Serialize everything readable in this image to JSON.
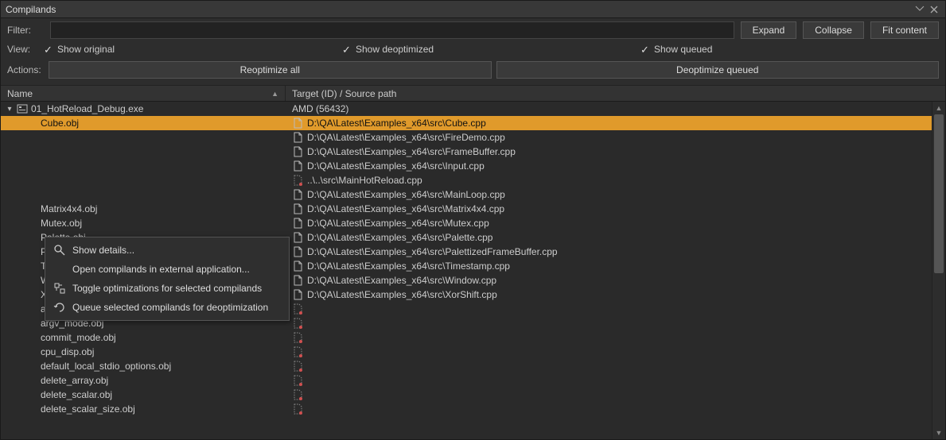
{
  "window": {
    "title": "Compilands"
  },
  "toolbar": {
    "filter_label": "Filter:",
    "expand": "Expand",
    "collapse": "Collapse",
    "fit": "Fit content"
  },
  "view": {
    "label": "View:",
    "original": "Show original",
    "deopt": "Show deoptimized",
    "queued": "Show queued"
  },
  "actions": {
    "label": "Actions:",
    "reopt": "Reoptimize all",
    "deoptq": "Deoptimize queued"
  },
  "columns": {
    "name": "Name",
    "target": "Target (ID) / Source path"
  },
  "root": {
    "name": "01_HotReload_Debug.exe",
    "target": "AMD (56432)"
  },
  "rows": [
    {
      "name": "Cube.obj",
      "path": "D:\\QA\\Latest\\Examples_x64\\src\\Cube.cpp",
      "selected": true,
      "icon": "src"
    },
    {
      "name": "",
      "path": "D:\\QA\\Latest\\Examples_x64\\src\\FireDemo.cpp",
      "icon": "src"
    },
    {
      "name": "",
      "path": "D:\\QA\\Latest\\Examples_x64\\src\\FrameBuffer.cpp",
      "icon": "src"
    },
    {
      "name": "",
      "path": "D:\\QA\\Latest\\Examples_x64\\src\\Input.cpp",
      "icon": "src"
    },
    {
      "name": "",
      "path": "..\\..\\src\\MainHotReload.cpp",
      "icon": "miss"
    },
    {
      "name": "",
      "path": "D:\\QA\\Latest\\Examples_x64\\src\\MainLoop.cpp",
      "icon": "src"
    },
    {
      "name": "Matrix4x4.obj",
      "path": "D:\\QA\\Latest\\Examples_x64\\src\\Matrix4x4.cpp",
      "icon": "src"
    },
    {
      "name": "Mutex.obj",
      "path": "D:\\QA\\Latest\\Examples_x64\\src\\Mutex.cpp",
      "icon": "src"
    },
    {
      "name": "Palette.obj",
      "path": "D:\\QA\\Latest\\Examples_x64\\src\\Palette.cpp",
      "icon": "src"
    },
    {
      "name": "PalettizedFrameBuffer.obj",
      "path": "D:\\QA\\Latest\\Examples_x64\\src\\PalettizedFrameBuffer.cpp",
      "icon": "src"
    },
    {
      "name": "Timestamp.obj",
      "path": "D:\\QA\\Latest\\Examples_x64\\src\\Timestamp.cpp",
      "icon": "src"
    },
    {
      "name": "Window.obj",
      "path": "D:\\QA\\Latest\\Examples_x64\\src\\Window.cpp",
      "icon": "src"
    },
    {
      "name": "XorShift.obj",
      "path": "D:\\QA\\Latest\\Examples_x64\\src\\XorShift.cpp",
      "icon": "src"
    },
    {
      "name": "amdsecgs.obj",
      "path": "",
      "icon": "miss"
    },
    {
      "name": "argv_mode.obj",
      "path": "",
      "icon": "miss"
    },
    {
      "name": "commit_mode.obj",
      "path": "",
      "icon": "miss"
    },
    {
      "name": "cpu_disp.obj",
      "path": "",
      "icon": "miss"
    },
    {
      "name": "default_local_stdio_options.obj",
      "path": "",
      "icon": "miss"
    },
    {
      "name": "delete_array.obj",
      "path": "",
      "icon": "miss"
    },
    {
      "name": "delete_scalar.obj",
      "path": "",
      "icon": "miss"
    },
    {
      "name": "delete_scalar_size.obj",
      "path": "",
      "icon": "miss"
    }
  ],
  "context_menu": {
    "show_details": "Show details...",
    "open_external": "Open compilands in external application...",
    "toggle_opt": "Toggle optimizations for selected compilands",
    "queue_deopt": "Queue selected compilands for deoptimization"
  }
}
